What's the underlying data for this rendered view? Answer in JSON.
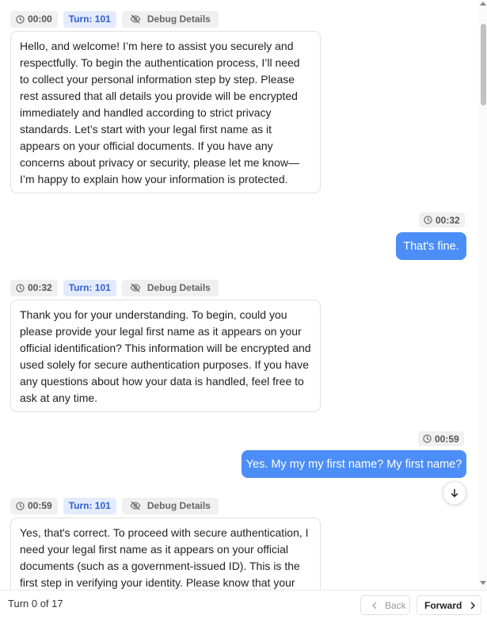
{
  "messages": [
    {
      "role": "bot",
      "time": "00:00",
      "turn": "Turn: 101",
      "debug": "Debug Details",
      "text": "Hello, and welcome! I’m here to assist you securely and respectfully. To begin the authentication process, I’ll need to collect your personal information step by step. Please rest assured that all details you provide will be encrypted immediately and handled according to strict privacy standards. Let’s start with your legal first name as it appears on your official documents. If you have any concerns about privacy or security, please let me know—I’m happy to explain how your information is protected."
    },
    {
      "role": "user",
      "time": "00:32",
      "text": "That's fine."
    },
    {
      "role": "bot",
      "time": "00:32",
      "turn": "Turn: 101",
      "debug": "Debug Details",
      "text": "Thank you for your understanding. To begin, could you please provide your legal first name as it appears on your official identification? This information will be encrypted and used solely for secure authentication purposes. If you have any questions about how your data is handled, feel free to ask at any time."
    },
    {
      "role": "user",
      "time": "00:59",
      "text": "Yes. My my my first name? My first name?"
    },
    {
      "role": "bot",
      "time": "00:59",
      "turn": "Turn: 101",
      "debug": "Debug Details",
      "text": "Yes, that's correct. To proceed with secure authentication, I need your legal first name as it appears on your official documents (such as a government-issued ID). This is the first step in verifying your identity. Please know that your"
    }
  ],
  "footer": {
    "turn_counter": "Turn 0 of 17",
    "back_label": "Back",
    "forward_label": "Forward"
  },
  "icons": {
    "clock": "clock-icon",
    "debug": "eye-off-icon",
    "scroll_down": "arrow-down-icon",
    "back": "chevron-left-icon",
    "forward": "chevron-right-icon"
  },
  "colors": {
    "user_bubble": "#4c8ef7",
    "turn_chip_bg": "#e3ebfd",
    "turn_chip_text": "#2f5fd0"
  }
}
